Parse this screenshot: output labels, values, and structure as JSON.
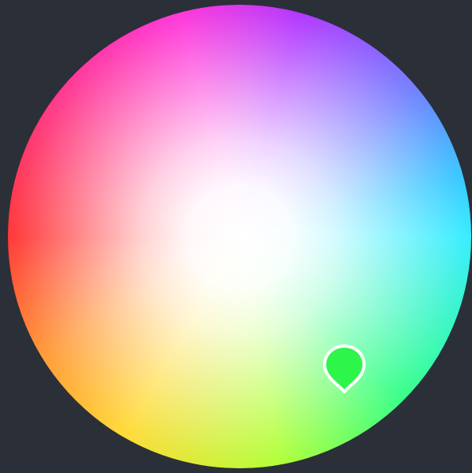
{
  "color_picker": {
    "selected_color": "#2ef54a",
    "thumb_outline_color": "#ffffff",
    "background_color": "#2b2f38",
    "wheel_hues": [
      "#ff0000",
      "#ffd000",
      "#9cff00",
      "#00ff66",
      "#00e8ff",
      "#4a5cff",
      "#9d00ff",
      "#ff00d0",
      "#ff0080"
    ],
    "thumb_icon": "map-pin-icon"
  }
}
